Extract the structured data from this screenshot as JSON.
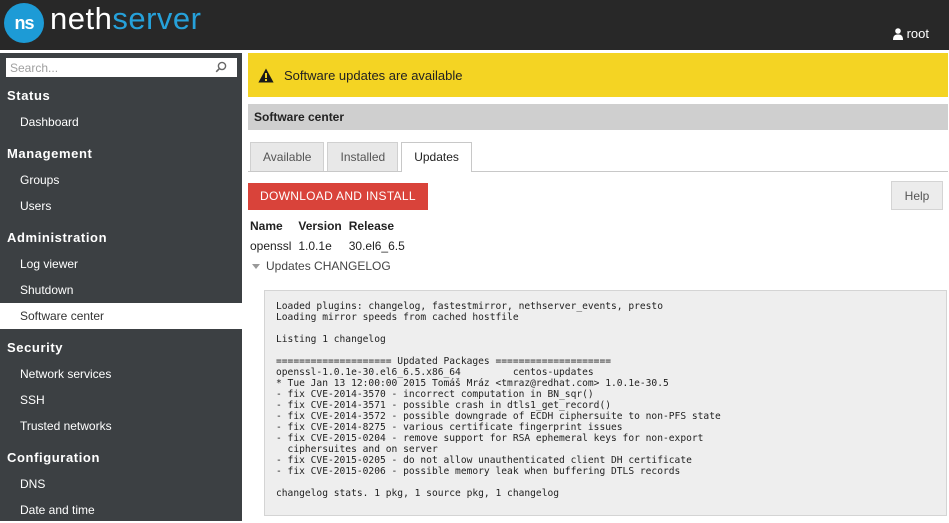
{
  "header": {
    "logo_mark": "ns",
    "logo_part1": "neth",
    "logo_part2": "server",
    "user": "root",
    "user_icon": "user-icon"
  },
  "colors": {
    "brand_blue": "#1d9bd6",
    "alert_yellow": "#f4d423",
    "primary_red": "#d9433a",
    "sidebar_bg": "#3c4043"
  },
  "sidebar": {
    "search_placeholder": "Search...",
    "search_icon": "search-icon",
    "sections": [
      {
        "title": "Status",
        "items": [
          "Dashboard"
        ]
      },
      {
        "title": "Management",
        "items": [
          "Groups",
          "Users"
        ]
      },
      {
        "title": "Administration",
        "items": [
          "Log viewer",
          "Shutdown",
          "Software center"
        ]
      },
      {
        "title": "Security",
        "items": [
          "Network services",
          "SSH",
          "Trusted networks"
        ]
      },
      {
        "title": "Configuration",
        "items": [
          "DNS",
          "Date and time"
        ]
      }
    ],
    "active_item": "Software center"
  },
  "alert": {
    "icon": "warning-icon",
    "text": "Software updates are available"
  },
  "panel": {
    "title": "Software center"
  },
  "tabs": [
    {
      "label": "Available",
      "active": false
    },
    {
      "label": "Installed",
      "active": false
    },
    {
      "label": "Updates",
      "active": true
    }
  ],
  "actions": {
    "download_install": "DOWNLOAD AND INSTALL",
    "help": "Help"
  },
  "packages": {
    "columns": [
      "Name",
      "Version",
      "Release"
    ],
    "rows": [
      [
        "openssl",
        "1.0.1e",
        "30.el6_6.5"
      ]
    ]
  },
  "changelog": {
    "toggle_label": "Updates CHANGELOG",
    "lines": [
      "Loaded plugins: changelog, fastestmirror, nethserver_events, presto",
      "Loading mirror speeds from cached hostfile",
      "",
      "Listing 1 changelog",
      "",
      "==================== Updated Packages ====================",
      "openssl-1.0.1e-30.el6_6.5.x86_64         centos-updates",
      "* Tue Jan 13 12:00:00 2015 Tomáš Mráz <tmraz@redhat.com> 1.0.1e-30.5",
      "- fix CVE-2014-3570 - incorrect computation in BN_sqr()",
      "- fix CVE-2014-3571 - possible crash in dtls1_get_record()",
      "- fix CVE-2014-3572 - possible downgrade of ECDH ciphersuite to non-PFS state",
      "- fix CVE-2014-8275 - various certificate fingerprint issues",
      "- fix CVE-2015-0204 - remove support for RSA ephemeral keys for non-export",
      "  ciphersuites and on server",
      "- fix CVE-2015-0205 - do not allow unauthenticated client DH certificate",
      "- fix CVE-2015-0206 - possible memory leak when buffering DTLS records",
      "",
      "changelog stats. 1 pkg, 1 source pkg, 1 changelog"
    ]
  }
}
